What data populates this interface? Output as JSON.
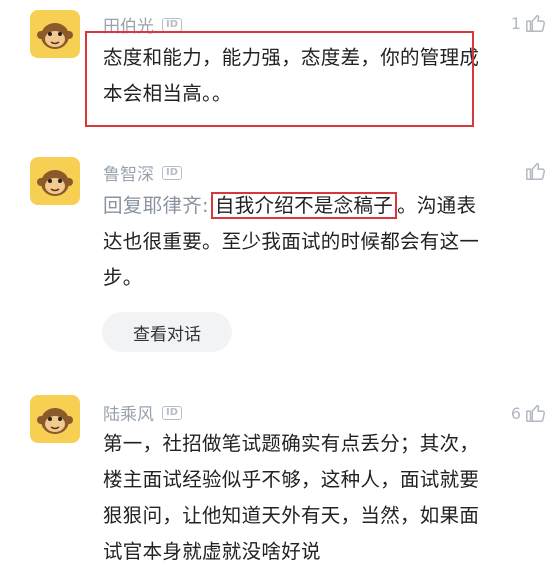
{
  "comments": [
    {
      "user": "田伯光",
      "id_badge": "ID",
      "likes": "1",
      "content": "态度和能力，能力强，态度差，你的管理成本会相当高。。"
    },
    {
      "user": "鲁智深",
      "id_badge": "ID",
      "likes": "",
      "reply_prefix": "回复耶律齐:",
      "highlight": "自我介绍不是念稿子",
      "content_rest": "。沟通表达也很重要。至少我面试的时候都会有这一步。",
      "view_conversation": "查看对话"
    },
    {
      "user": "陆乘风",
      "id_badge": "ID",
      "likes": "6",
      "content": "第一，社招做笔试题确实有点丢分；其次，楼主面试经验似乎不够，这种人，面试就要狠狠问，让他知道天外有天，当然，如果面试官本身就虚就没啥好说"
    }
  ],
  "colors": {
    "highlight_border": "#d9383a",
    "avatar_bg": "#f7cf52",
    "username": "#9aa3ad"
  },
  "icons": {
    "like": "thumbs-up-icon",
    "avatar": "monkey-avatar-icon"
  }
}
